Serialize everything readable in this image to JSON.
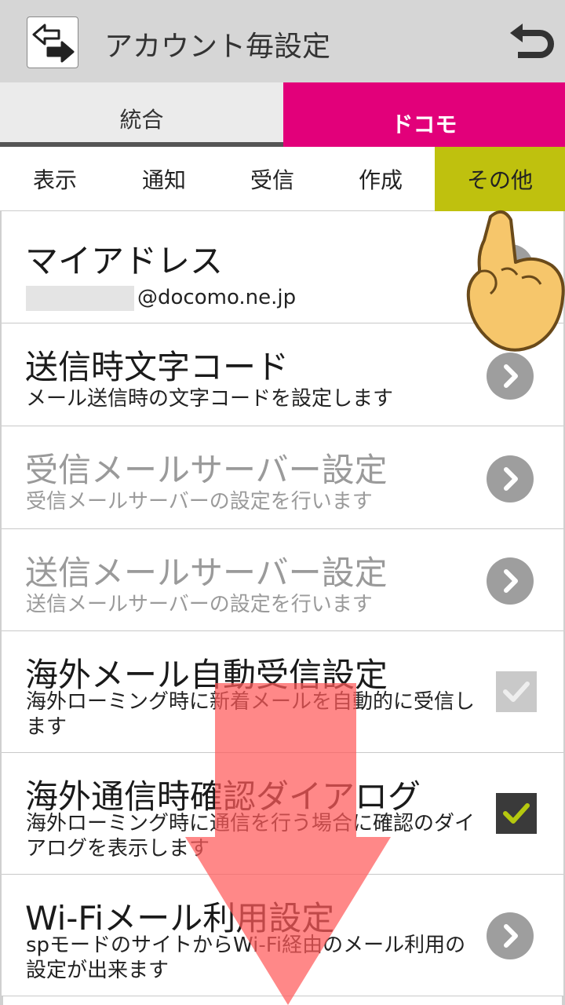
{
  "header": {
    "title": "アカウント毎設定",
    "icon": "account-switch-icon",
    "back_icon": "back-arrow-icon"
  },
  "account_tabs": [
    {
      "label": "統合",
      "active": false
    },
    {
      "label": "ドコモ",
      "active": true
    }
  ],
  "category_tabs": [
    {
      "label": "表示",
      "active": false
    },
    {
      "label": "通知",
      "active": false
    },
    {
      "label": "受信",
      "active": false
    },
    {
      "label": "作成",
      "active": false
    },
    {
      "label": "その他",
      "active": true
    }
  ],
  "rows": [
    {
      "title": "マイアドレス",
      "subtitle": "@docomo.ne.jp",
      "control": "chevron",
      "enabled": true
    },
    {
      "title": "送信時文字コード",
      "subtitle": "メール送信時の文字コードを設定します",
      "control": "chevron",
      "enabled": true
    },
    {
      "title": "受信メールサーバー設定",
      "subtitle": "受信メールサーバーの設定を行います",
      "control": "chevron",
      "enabled": false
    },
    {
      "title": "送信メールサーバー設定",
      "subtitle": "送信メールサーバーの設定を行います",
      "control": "chevron",
      "enabled": false
    },
    {
      "title": "海外メール自動受信設定",
      "subtitle": "海外ローミング時に新着メールを自動的に受信します",
      "control": "checkbox",
      "checked": true,
      "enabled": false
    },
    {
      "title": "海外通信時確認ダイアログ",
      "subtitle": "海外ローミング時に通信を行う場合に確認のダイアログを表示します",
      "control": "checkbox",
      "checked": true,
      "enabled": true
    },
    {
      "title": "Wi-Fiメール利用設定",
      "subtitle": "spモードのサイトからWi-Fi経由のメール利用の設定が出来ます",
      "control": "chevron",
      "enabled": true
    }
  ],
  "colors": {
    "accent_docomo": "#e2007a",
    "accent_category": "#bfc10e",
    "check_green": "#b5c80f",
    "overlay_arrow": "#ff6f6f"
  }
}
